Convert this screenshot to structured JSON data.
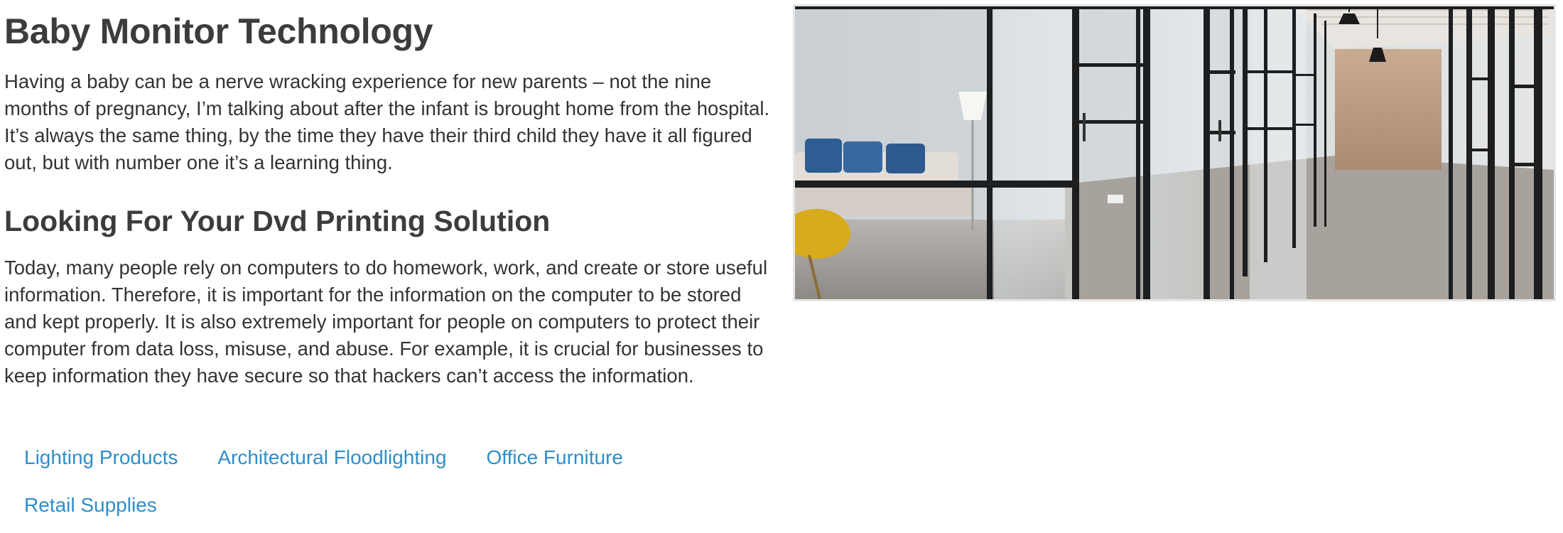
{
  "article": {
    "title": "Baby Monitor Technology",
    "intro": "Having a baby can be a nerve wracking experience for new parents – not the nine months of pregnancy, I’m talking about after the infant is brought home from the hospital. It’s always the same thing, by the time they have their third child they have it all figured out, but with number one it’s a learning thing.",
    "subtitle": "Looking For Your Dvd Printing Solution",
    "body": "Today, many people rely on computers to do homework, work, and create or store useful information. Therefore, it is important for the information on the computer to be stored and kept properly. It is also extremely important for people on computers to protect their computer from data loss, misuse, and abuse. For example, it is crucial for businesses to keep information they have secure so that hackers can’t access the information."
  },
  "links": [
    {
      "label": "Lighting Products"
    },
    {
      "label": "Architectural Floodlighting"
    },
    {
      "label": "Office Furniture"
    },
    {
      "label": "Retail Supplies"
    }
  ],
  "colors": {
    "text": "#333333",
    "heading": "#3c3c3c",
    "link": "#2e8ec9",
    "image_border": "#e6e6e6"
  }
}
